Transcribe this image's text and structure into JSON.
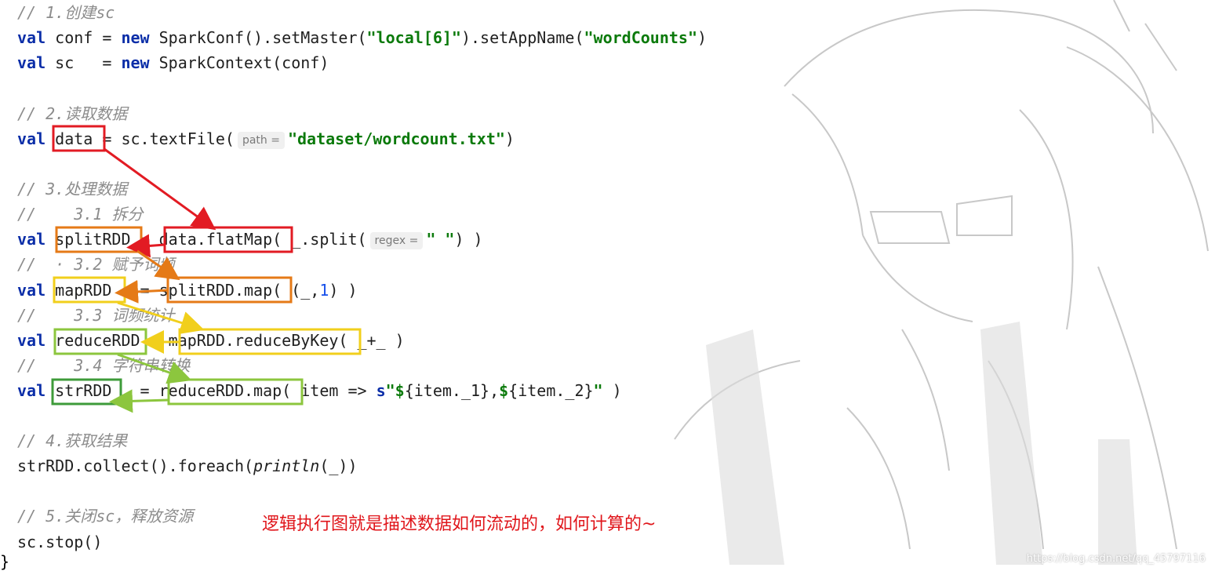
{
  "code": {
    "c1": "// 1.创建sc",
    "l1": {
      "kw": "val",
      "name": " conf",
      "eq": " = ",
      "kw2": "new",
      "rest1": " SparkConf().setMaster(",
      "s1": "\"local[6]\"",
      "rest2": ").setAppName(",
      "s2": "\"wordCounts\"",
      "rest3": ")"
    },
    "l2": {
      "kw": "val",
      "name": " sc   = ",
      "kw2": "new",
      "rest": " SparkContext(conf)"
    },
    "c2": "// 2.读取数据",
    "l3": {
      "kw": "val",
      "text": " data = sc.textFile(",
      "hint": "path =",
      "str": "\"dataset/wordcount.txt\"",
      "end": ")"
    },
    "c3": "// 3.处理数据",
    "c31": "//    3.1 拆分",
    "l4": {
      "kw": "val",
      "text": " splitRDD = data.flatMap( _.split(",
      "hint": "regex =",
      "str": "\" \"",
      "end": ") )"
    },
    "c32": "//  · 3.2 赋予词频",
    "l5": {
      "kw": "val",
      "text": " mapRDD   = splitRDD.map( (_,",
      "num": "1",
      "end": ") )"
    },
    "c33": "//    3.3 词频统计",
    "l6": {
      "kw": "val",
      "text": " reduceRDD = mapRDD.reduceByKey( _+_ )"
    },
    "c34": "//    3.4 字符串转换",
    "l7": {
      "kw": "val",
      "text": " strRDD   = reduceRDD.map( item => ",
      "s": "s",
      "q1": "\"",
      "d1": "$",
      "i1": "{item._1},",
      "d2": "$",
      "i2": "{item._2}",
      "q2": "\"",
      "end": " )"
    },
    "c4": "// 4.获取结果",
    "l8": {
      "pre": "strRDD.collect().foreach(",
      "fn": "println",
      "post": "(_))"
    },
    "c5": "// 5.关闭sc，释放资源",
    "l9": "sc.stop()",
    "brace": "}"
  },
  "annotation": "逻辑执行图就是描述数据如何流动的，如何计算的~",
  "watermark": "https://blog.csdn.net/qq_45797116",
  "colors": {
    "red": "#e21b23",
    "orange": "#e57a17",
    "yellow": "#f1cf1c",
    "lightgreen": "#8cc63e",
    "darkgreen": "#3e9b3a",
    "note": "#e0161b"
  }
}
